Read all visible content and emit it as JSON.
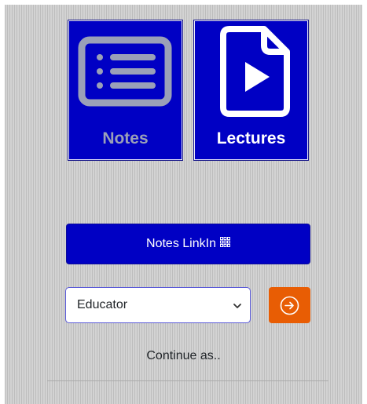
{
  "tiles": {
    "notes": {
      "label": "Notes",
      "icon": "list-card-icon"
    },
    "lectures": {
      "label": "Lectures",
      "icon": "video-file-icon"
    }
  },
  "linkin_button": {
    "label": "Notes LinkIn",
    "icon": "grid-icon"
  },
  "role_select": {
    "selected": "Educator",
    "icon": "chevron-down-icon"
  },
  "go_button": {
    "icon": "arrow-right-circle-icon"
  },
  "continue_text": "Continue as..",
  "colors": {
    "primary": "#0000c4",
    "accent": "#e85d04",
    "notes_label": "#9aa0b8"
  }
}
